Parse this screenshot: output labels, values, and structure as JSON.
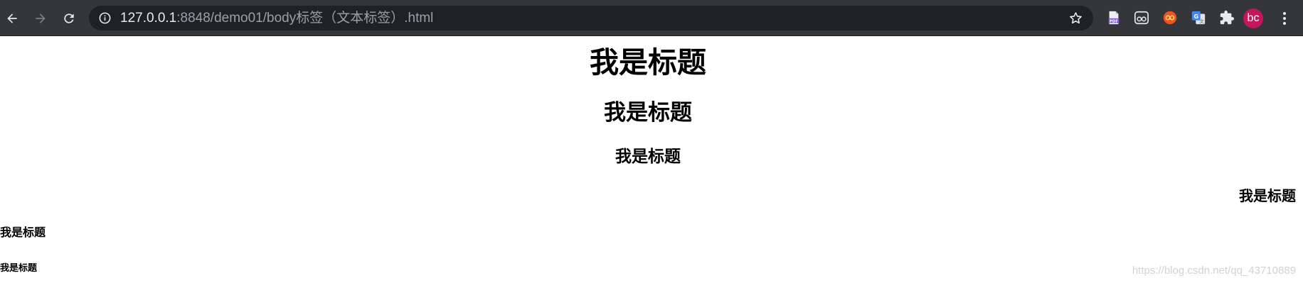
{
  "browser": {
    "url_host": "127.0.0.1",
    "url_path": ":8848/demo01/body标签（文本标签）.html",
    "profile_initials": "bc",
    "extensions": [
      "pdf-extension-icon",
      "reader-glasses-extension-icon",
      "infinity-extension-icon",
      "google-translate-extension-icon",
      "puzzle-extensions-icon"
    ],
    "colors": {
      "toolbar": "#35363a",
      "omnibox": "#202124",
      "avatar": "#c2185b"
    }
  },
  "page": {
    "headings": {
      "h1": "我是标题",
      "h2": "我是标题",
      "h3": "我是标题",
      "h4": "我是标题",
      "h5": "我是标题",
      "h6": "我是标题"
    },
    "watermark": "https://blog.csdn.net/qq_43710889"
  }
}
